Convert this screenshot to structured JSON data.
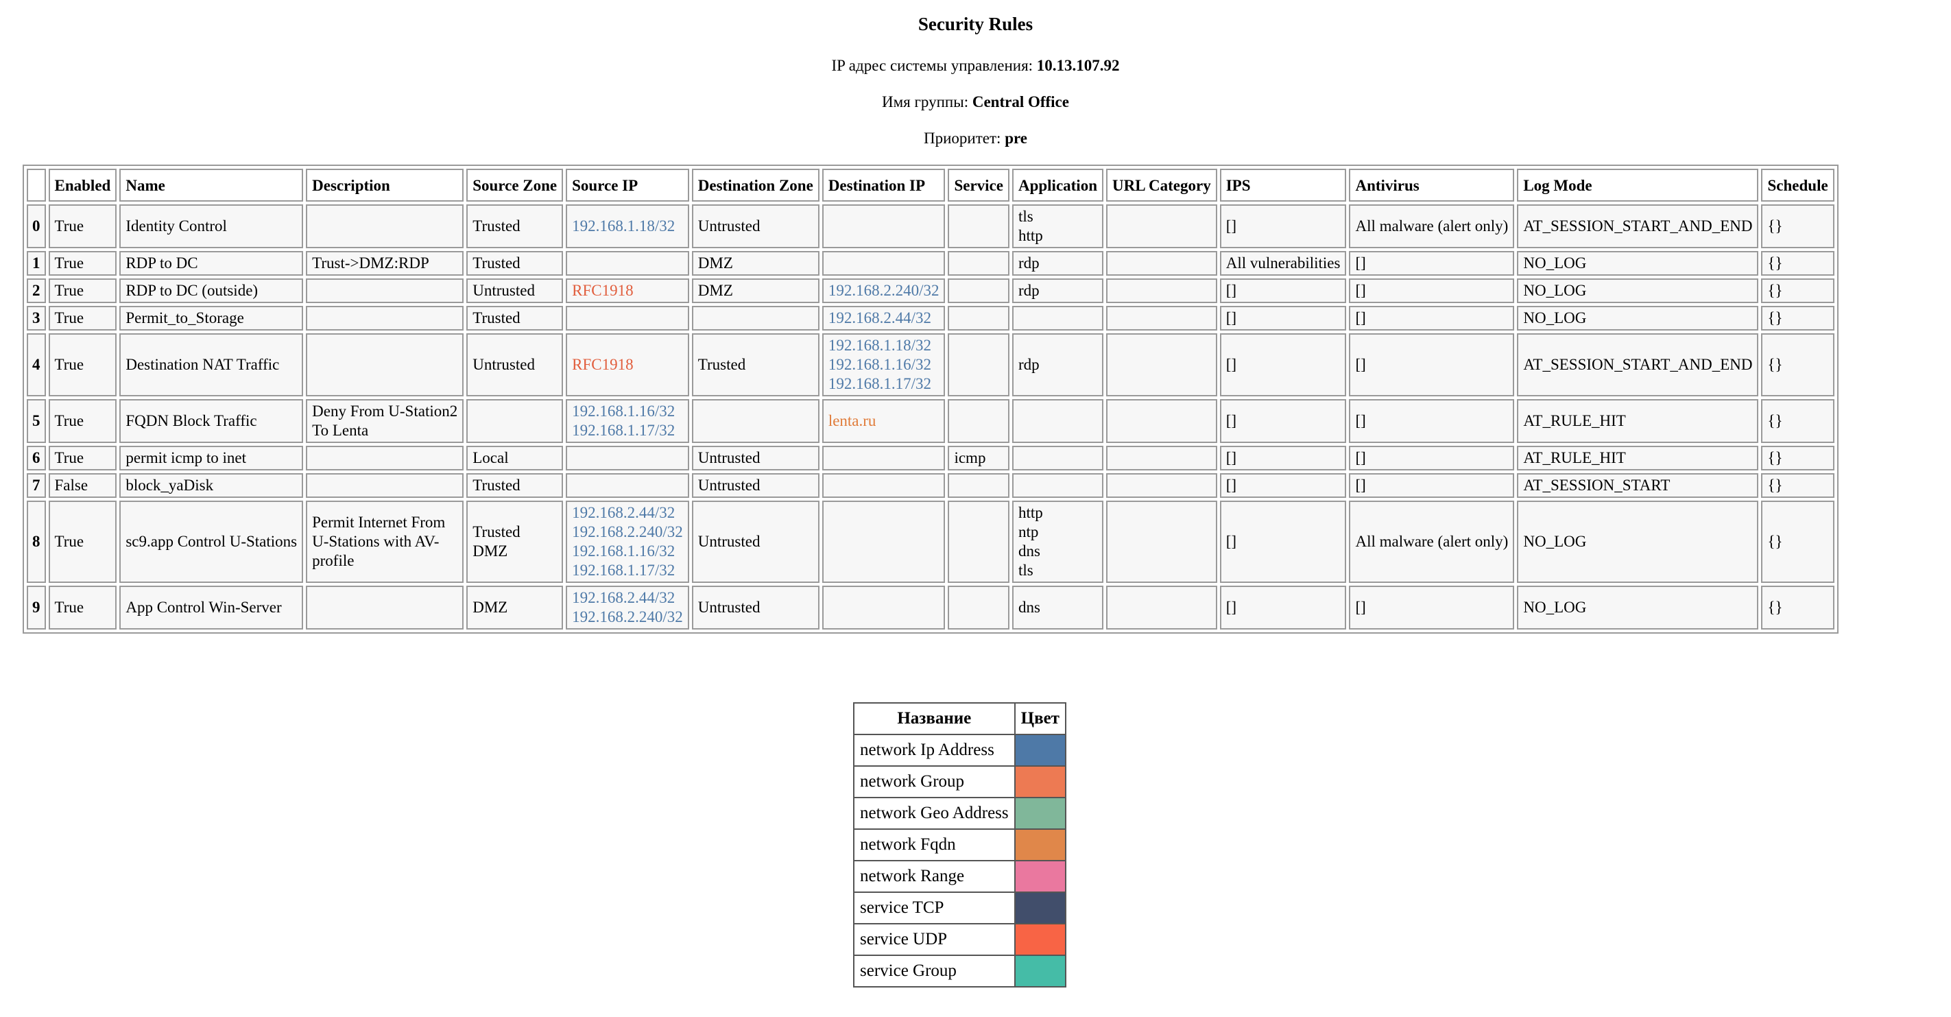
{
  "header": {
    "title": "Security Rules",
    "ip_label": "IP адрес системы управления: ",
    "ip_value": "10.13.107.92",
    "group_label": "Имя группы: ",
    "group_value": "Central Office",
    "priority_label": "Приоритет: ",
    "priority_value": "pre"
  },
  "rules": {
    "columns": [
      "",
      "Enabled",
      "Name",
      "Description",
      "Source Zone",
      "Source IP",
      "Destination Zone",
      "Destination IP",
      "Service",
      "Application",
      "URL Category",
      "IPS",
      "Antivirus",
      "Log Mode",
      "Schedule"
    ],
    "rows": [
      {
        "idx": "0",
        "enabled": "True",
        "name": "Identity Control",
        "description": [],
        "source_zone": [
          "Trusted"
        ],
        "source_ip": [
          {
            "text": "192.168.1.18/32",
            "kind": "ip"
          }
        ],
        "destination_zone": [
          "Untrusted"
        ],
        "destination_ip": [],
        "service": [],
        "application": [
          "tls",
          "http"
        ],
        "url_category": [],
        "ips": "[]",
        "antivirus": "All malware (alert only)",
        "log_mode": "AT_SESSION_START_AND_END",
        "schedule": "{}"
      },
      {
        "idx": "1",
        "enabled": "True",
        "name": "RDP to DC",
        "description": [
          "Trust->DMZ:RDP"
        ],
        "source_zone": [
          "Trusted"
        ],
        "source_ip": [],
        "destination_zone": [
          "DMZ"
        ],
        "destination_ip": [],
        "service": [],
        "application": [
          "rdp"
        ],
        "url_category": [],
        "ips": "All vulnerabilities",
        "antivirus": "[]",
        "log_mode": "NO_LOG",
        "schedule": "{}"
      },
      {
        "idx": "2",
        "enabled": "True",
        "name": "RDP to DC (outside)",
        "description": [],
        "source_zone": [
          "Untrusted"
        ],
        "source_ip": [
          {
            "text": "RFC1918",
            "kind": "group"
          }
        ],
        "destination_zone": [
          "DMZ"
        ],
        "destination_ip": [
          {
            "text": "192.168.2.240/32",
            "kind": "ip"
          }
        ],
        "service": [],
        "application": [
          "rdp"
        ],
        "url_category": [],
        "ips": "[]",
        "antivirus": "[]",
        "log_mode": "NO_LOG",
        "schedule": "{}"
      },
      {
        "idx": "3",
        "enabled": "True",
        "name": "Permit_to_Storage",
        "description": [],
        "source_zone": [
          "Trusted"
        ],
        "source_ip": [],
        "destination_zone": [],
        "destination_ip": [
          {
            "text": "192.168.2.44/32",
            "kind": "ip"
          }
        ],
        "service": [],
        "application": [],
        "url_category": [],
        "ips": "[]",
        "antivirus": "[]",
        "log_mode": "NO_LOG",
        "schedule": "{}"
      },
      {
        "idx": "4",
        "enabled": "True",
        "name": "Destination NAT Traffic",
        "description": [],
        "source_zone": [
          "Untrusted"
        ],
        "source_ip": [
          {
            "text": "RFC1918",
            "kind": "group"
          }
        ],
        "destination_zone": [
          "Trusted"
        ],
        "destination_ip": [
          {
            "text": "192.168.1.18/32",
            "kind": "ip"
          },
          {
            "text": "192.168.1.16/32",
            "kind": "ip"
          },
          {
            "text": "192.168.1.17/32",
            "kind": "ip"
          }
        ],
        "service": [],
        "application": [
          "rdp"
        ],
        "url_category": [],
        "ips": "[]",
        "antivirus": "[]",
        "log_mode": "AT_SESSION_START_AND_END",
        "schedule": "{}"
      },
      {
        "idx": "5",
        "enabled": "True",
        "name": "FQDN Block Traffic",
        "description": [
          "Deny From U-Station2",
          "To Lenta"
        ],
        "source_zone": [],
        "source_ip": [
          {
            "text": "192.168.1.16/32",
            "kind": "ip"
          },
          {
            "text": "192.168.1.17/32",
            "kind": "ip"
          }
        ],
        "destination_zone": [],
        "destination_ip": [
          {
            "text": "lenta.ru",
            "kind": "fqdn"
          }
        ],
        "service": [],
        "application": [],
        "url_category": [],
        "ips": "[]",
        "antivirus": "[]",
        "log_mode": "AT_RULE_HIT",
        "schedule": "{}"
      },
      {
        "idx": "6",
        "enabled": "True",
        "name": "permit icmp to inet",
        "description": [],
        "source_zone": [
          "Local"
        ],
        "source_ip": [],
        "destination_zone": [
          "Untrusted"
        ],
        "destination_ip": [],
        "service": [
          "icmp"
        ],
        "application": [],
        "url_category": [],
        "ips": "[]",
        "antivirus": "[]",
        "log_mode": "AT_RULE_HIT",
        "schedule": "{}"
      },
      {
        "idx": "7",
        "enabled": "False",
        "name": "block_yaDisk",
        "description": [],
        "source_zone": [
          "Trusted"
        ],
        "source_ip": [],
        "destination_zone": [
          "Untrusted"
        ],
        "destination_ip": [],
        "service": [],
        "application": [],
        "url_category": [],
        "ips": "[]",
        "antivirus": "[]",
        "log_mode": "AT_SESSION_START",
        "schedule": "{}"
      },
      {
        "idx": "8",
        "enabled": "True",
        "name": "sc9.app Control U-Stations",
        "description": [
          "Permit Internet From",
          "U-Stations with AV-",
          "profile"
        ],
        "source_zone": [
          "Trusted",
          "DMZ"
        ],
        "source_ip": [
          {
            "text": "192.168.2.44/32",
            "kind": "ip"
          },
          {
            "text": "192.168.2.240/32",
            "kind": "ip"
          },
          {
            "text": "192.168.1.16/32",
            "kind": "ip"
          },
          {
            "text": "192.168.1.17/32",
            "kind": "ip"
          }
        ],
        "destination_zone": [
          "Untrusted"
        ],
        "destination_ip": [],
        "service": [],
        "application": [
          "http",
          "ntp",
          "dns",
          "tls"
        ],
        "url_category": [],
        "ips": "[]",
        "antivirus": "All malware (alert only)",
        "log_mode": "NO_LOG",
        "schedule": "{}"
      },
      {
        "idx": "9",
        "enabled": "True",
        "name": "App Control Win-Server",
        "description": [],
        "source_zone": [
          "DMZ"
        ],
        "source_ip": [
          {
            "text": "192.168.2.44/32",
            "kind": "ip"
          },
          {
            "text": "192.168.2.240/32",
            "kind": "ip"
          }
        ],
        "destination_zone": [
          "Untrusted"
        ],
        "destination_ip": [],
        "service": [],
        "application": [
          "dns"
        ],
        "url_category": [],
        "ips": "[]",
        "antivirus": "[]",
        "log_mode": "NO_LOG",
        "schedule": "{}"
      }
    ]
  },
  "legend": {
    "name_header": "Название",
    "color_header": "Цвет",
    "items": [
      {
        "name": "network Ip Address",
        "color": "#4e79a7"
      },
      {
        "name": "network Group",
        "color": "#ed7a53"
      },
      {
        "name": "network Geo Address",
        "color": "#80b79a"
      },
      {
        "name": "network Fqdn",
        "color": "#e0874a"
      },
      {
        "name": "network Range",
        "color": "#ea789f"
      },
      {
        "name": "service TCP",
        "color": "#414e6b"
      },
      {
        "name": "service UDP",
        "color": "#f86445"
      },
      {
        "name": "service Group",
        "color": "#45bca7"
      }
    ]
  },
  "colors": {
    "ip": "#4e79a7",
    "group": "#e8684a",
    "fqdn": "#e0873d"
  }
}
